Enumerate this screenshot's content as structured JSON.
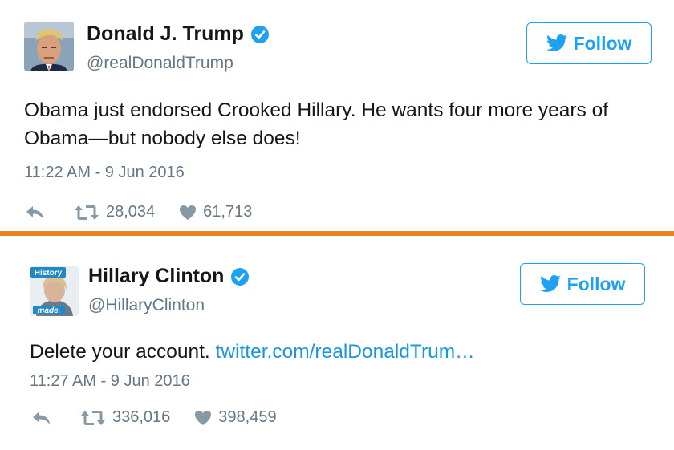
{
  "tweets": [
    {
      "display_name": "Donald J. Trump",
      "handle": "@realDonaldTrump",
      "verified": true,
      "follow_label": "Follow",
      "text": "Obama just endorsed Crooked Hillary. He wants four more years of Obama—but nobody else does!",
      "timestamp": "11:22 AM - 9 Jun 2016",
      "retweets": "28,034",
      "likes": "61,713"
    },
    {
      "display_name": "Hillary Clinton",
      "handle": "@HillaryClinton",
      "verified": true,
      "follow_label": "Follow",
      "text": "Delete your account.",
      "link_text": "twitter.com/realDonaldTrum…",
      "avatar_badge_top": "History",
      "avatar_badge_bottom": "made.",
      "timestamp": "11:27 AM - 9 Jun 2016",
      "retweets": "336,016",
      "likes": "398,459"
    }
  ],
  "colors": {
    "divider": "#e8841f",
    "twitter_blue": "#1da1f2",
    "link": "#1b95e0",
    "muted": "#657786"
  }
}
